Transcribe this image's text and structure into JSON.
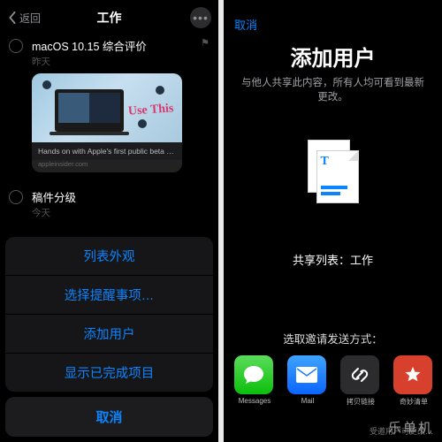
{
  "left": {
    "nav": {
      "back": "返回",
      "title": "工作"
    },
    "task1": {
      "title": "macOS 10.15 综合评价",
      "date": "昨天",
      "preview_caption": "Hands on with Apple's first public beta of m...",
      "preview_source": "appleinsider.com",
      "scribble": "Use\nThis"
    },
    "task2": {
      "title": "稿件分级",
      "date": "今天"
    },
    "sheet": [
      "列表外观",
      "选择提醒事项…",
      "添加用户",
      "显示已完成项目"
    ],
    "cancel": "取消"
  },
  "right": {
    "cancel": "取消",
    "title": "添加用户",
    "desc": "与他人共享此内容，所有人均可看到最新\n更改。",
    "share_label": "共享列表：工作",
    "send_label": "选取邀请发送方式：",
    "apps": [
      {
        "label": "Messages",
        "icon": "messages"
      },
      {
        "label": "Mail",
        "icon": "mail"
      },
      {
        "label": "拷贝链接",
        "icon": "copy"
      },
      {
        "label": "奇妙清单",
        "icon": "wunder"
      }
    ],
    "footer": "受邀用户可更改…"
  },
  "watermark": "乐单机"
}
